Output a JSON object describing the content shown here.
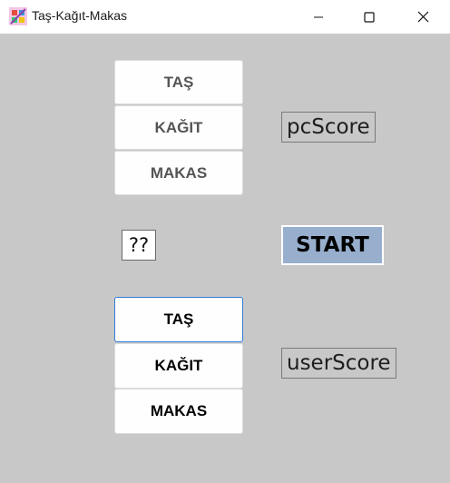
{
  "window": {
    "title": "Taş-Kağıt-Makas",
    "minimize_icon": "minimize-icon",
    "maximize_icon": "maximize-icon",
    "close_icon": "close-icon"
  },
  "pc_choices": [
    {
      "label": "TAŞ"
    },
    {
      "label": "KAĞIT"
    },
    {
      "label": "MAKAS"
    }
  ],
  "user_choices": [
    {
      "label": "TAŞ"
    },
    {
      "label": "KAĞIT"
    },
    {
      "label": "MAKAS"
    }
  ],
  "pc_score": "pcScore",
  "user_score": "userScore",
  "result_text": "??",
  "start_label": "START",
  "colors": {
    "client_bg": "#c8c8c8",
    "start_bg": "#97aecd",
    "focus_border": "#2f7ed8"
  }
}
